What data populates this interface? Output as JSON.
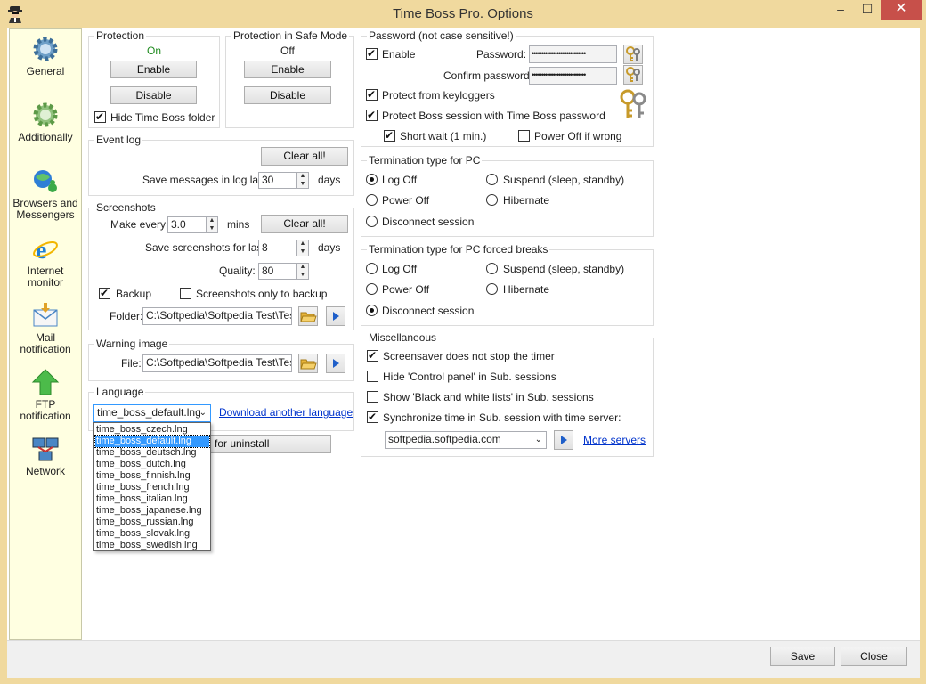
{
  "window": {
    "title": "Time Boss Pro. Options",
    "min": "–",
    "max": "☐",
    "close": "✕"
  },
  "sidebar": {
    "items": [
      {
        "label": "General",
        "icon": "gear-icon"
      },
      {
        "label": "Additionally",
        "icon": "gear-icon"
      },
      {
        "label": "Browsers and Messengers",
        "icon": "browser-messenger-icon"
      },
      {
        "label": "Internet monitor",
        "icon": "internet-explorer-icon"
      },
      {
        "label": "Mail notification",
        "icon": "mail-icon"
      },
      {
        "label": "FTP notification",
        "icon": "ftp-arrow-icon"
      },
      {
        "label": "Network",
        "icon": "network-icon"
      }
    ]
  },
  "protection": {
    "title": "Protection",
    "status": "On",
    "enable": "Enable",
    "disable": "Disable",
    "hide_folder": "Hide Time Boss folder"
  },
  "safe_mode": {
    "title": "Protection in Safe Mode",
    "status": "Off",
    "enable": "Enable",
    "disable": "Disable"
  },
  "event_log": {
    "title": "Event log",
    "clear": "Clear all!",
    "save_label": "Save messages in log last",
    "save_value": "30",
    "unit": "days"
  },
  "screenshots": {
    "title": "Screenshots",
    "make_every": "Make every",
    "make_every_value": "3.0",
    "mins": "mins",
    "clear": "Clear all!",
    "save_label": "Save screenshots for last",
    "save_value": "8",
    "days": "days",
    "quality_label": "Quality:",
    "quality_value": "80",
    "backup": "Backup",
    "only_backup": "Screenshots only to backup",
    "folder_label": "Folder:",
    "folder_value": "C:\\Softpedia\\Softpedia Test\\Test"
  },
  "warning_image": {
    "title": "Warning image",
    "file_label": "File:",
    "file_value": "C:\\Softpedia\\Softpedia Test\\Test"
  },
  "language": {
    "title": "Language",
    "selected": "time_boss_default.lng",
    "download": "Download another language",
    "hidden_button": "for uninstall",
    "options": [
      "time_boss_czech.lng",
      "time_boss_default.lng",
      "time_boss_deutsch.lng",
      "time_boss_dutch.lng",
      "time_boss_finnish.lng",
      "time_boss_french.lng",
      "time_boss_italian.lng",
      "time_boss_japanese.lng",
      "time_boss_russian.lng",
      "time_boss_slovak.lng",
      "time_boss_swedish.lng"
    ]
  },
  "password": {
    "title": "Password (not case sensitive!)",
    "enable": "Enable",
    "password_label": "Password:",
    "confirm_label": "Confirm password:",
    "mask": "••••••••••••••••••••••••••••",
    "keyloggers": "Protect from keyloggers",
    "protect_session": "Protect Boss session with Time Boss password",
    "short_wait": "Short wait (1 min.)",
    "power_off_wrong": "Power Off if wrong"
  },
  "termination": {
    "title": "Termination type for PC",
    "log_off": "Log Off",
    "suspend": "Suspend (sleep, standby)",
    "power_off": "Power Off",
    "hibernate": "Hibernate",
    "disconnect": "Disconnect session"
  },
  "termination_forced": {
    "title": "Termination type for PC forced breaks",
    "log_off": "Log Off",
    "suspend": "Suspend (sleep, standby)",
    "power_off": "Power Off",
    "hibernate": "Hibernate",
    "disconnect": "Disconnect session"
  },
  "misc": {
    "title": "Miscellaneous",
    "screensaver": "Screensaver does not stop the timer",
    "hide_cp": "Hide 'Control panel' in Sub. sessions",
    "show_lists": "Show 'Black and white lists' in Sub. sessions",
    "sync_time": "Synchronize time in Sub. session with time server:",
    "server": "softpedia.softpedia.com",
    "more_servers": "More servers"
  },
  "footer": {
    "save": "Save",
    "close": "Close"
  },
  "colors": {
    "frame": "#f0d99e",
    "sidebar": "#ffffe1",
    "selection": "#3399ff",
    "link": "#0033cc",
    "close": "#c7504a"
  }
}
